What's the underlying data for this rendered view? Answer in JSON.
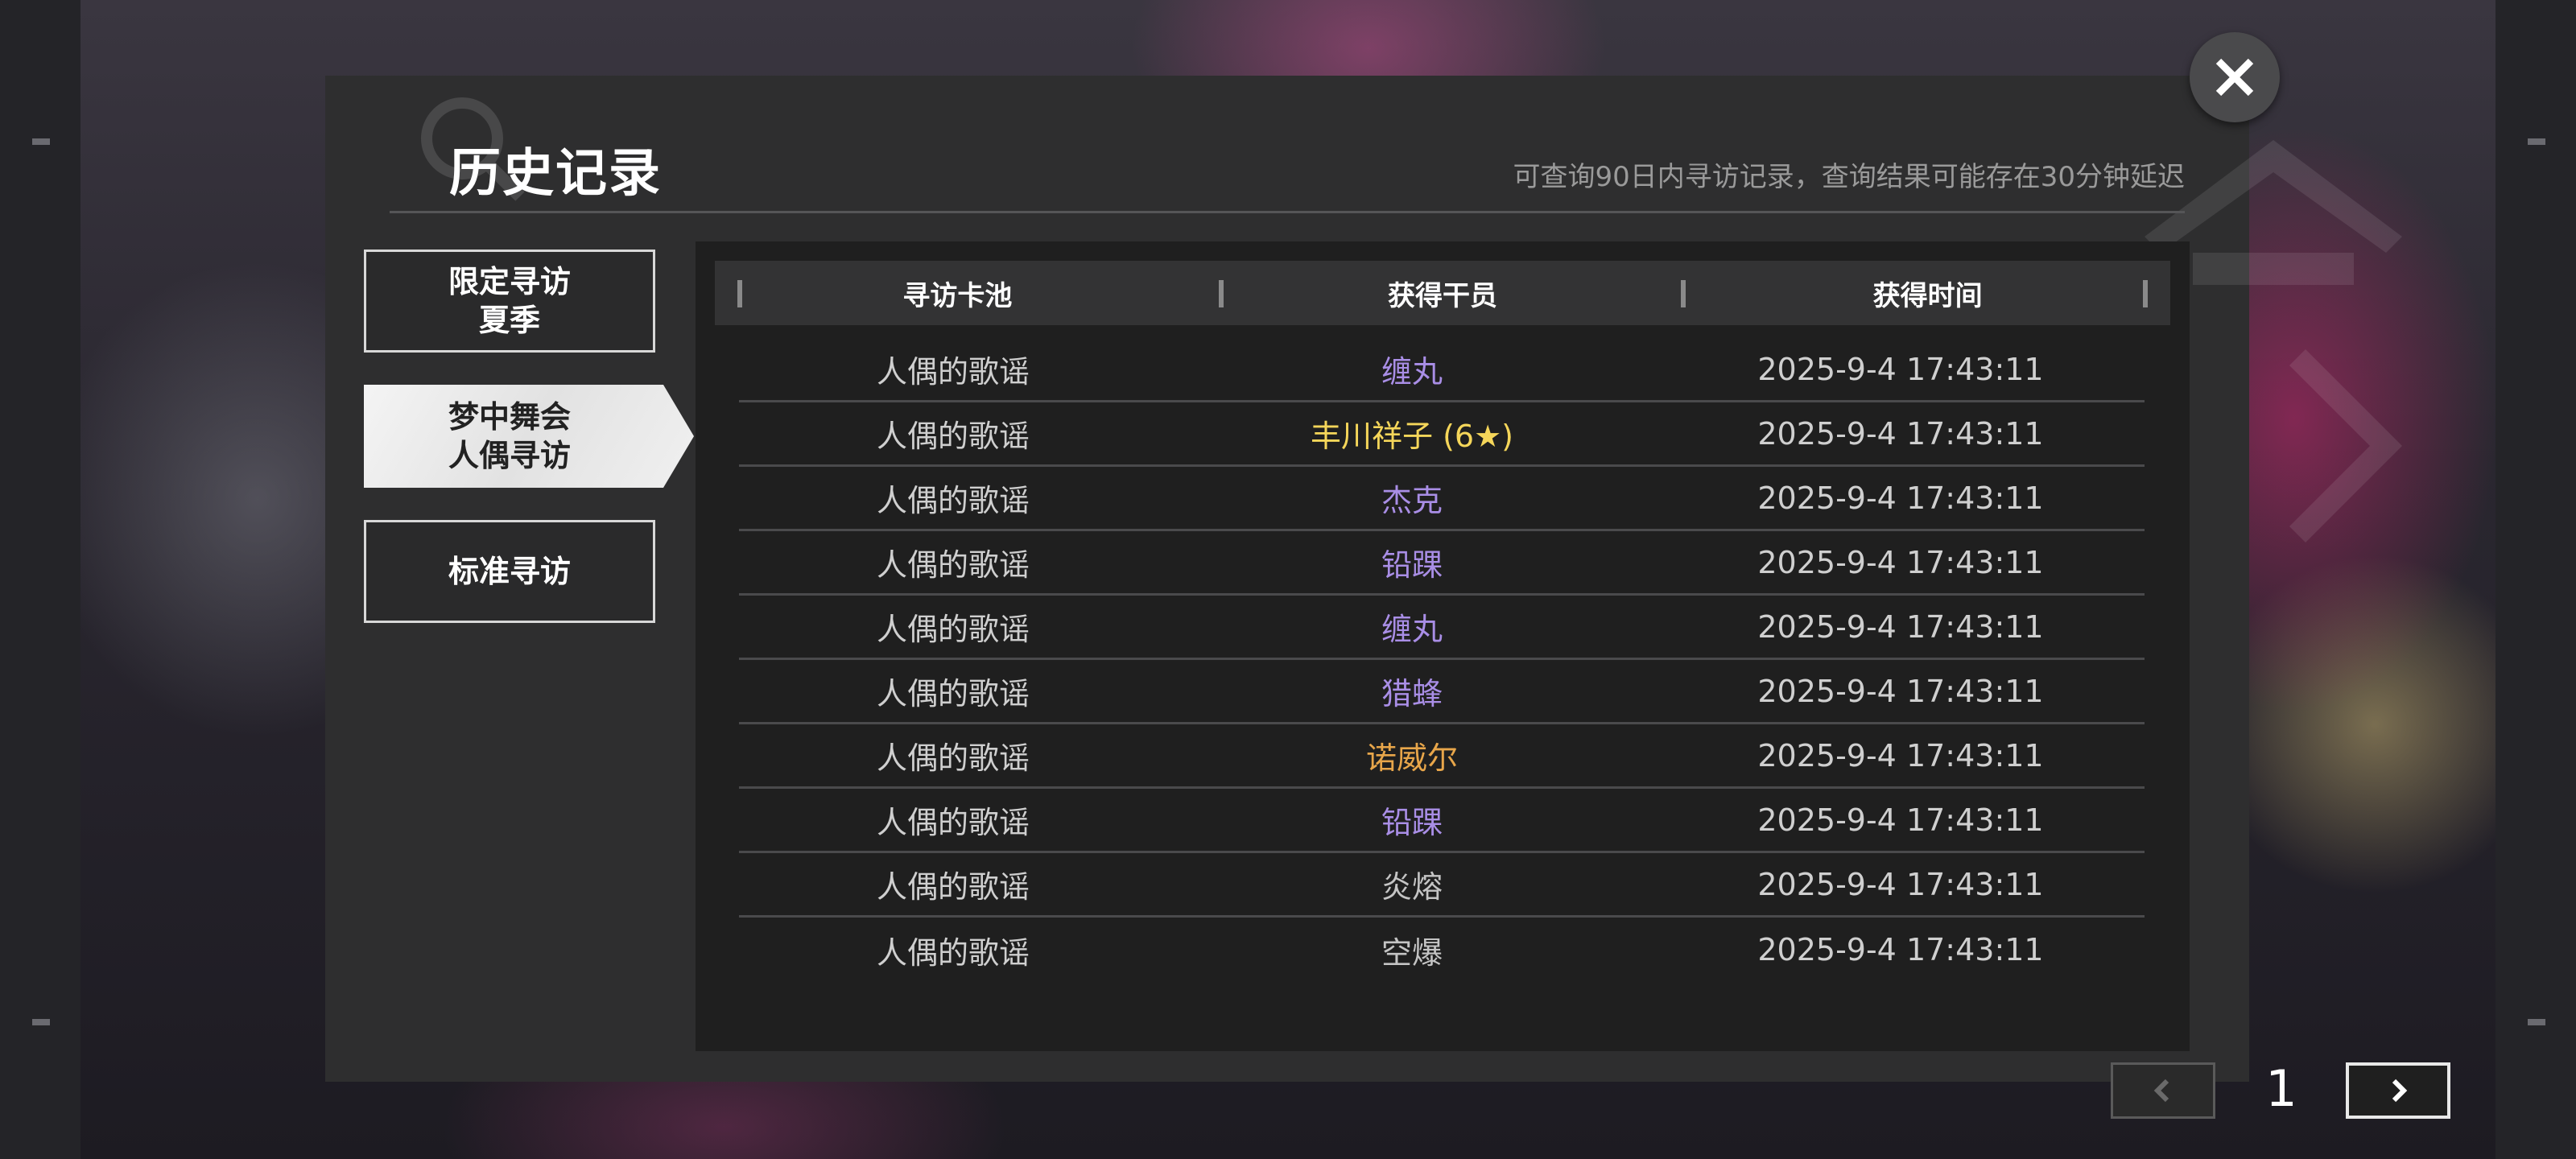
{
  "dialog": {
    "title": "历史记录",
    "subtitle": "可查询90日内寻访记录，查询结果可能存在30分钟延迟"
  },
  "tabs": [
    {
      "line1": "限定寻访",
      "line2": "夏季",
      "active": false
    },
    {
      "line1": "梦中舞会",
      "line2": "人偶寻访",
      "active": true
    },
    {
      "line1": "标准寻访",
      "line2": "",
      "active": false
    }
  ],
  "table": {
    "headers": [
      "寻访卡池",
      "获得干员",
      "获得时间"
    ],
    "rows": [
      {
        "pool": "人偶的歌谣",
        "operator": "缠丸",
        "time": "2025-9-4 17:43:11",
        "color": "#a98ee6"
      },
      {
        "pool": "人偶的歌谣",
        "operator": "丰川祥子 (6★)",
        "time": "2025-9-4 17:43:11",
        "color": "#f5d65a"
      },
      {
        "pool": "人偶的歌谣",
        "operator": "杰克",
        "time": "2025-9-4 17:43:11",
        "color": "#a98ee6"
      },
      {
        "pool": "人偶的歌谣",
        "operator": "铅踝",
        "time": "2025-9-4 17:43:11",
        "color": "#a98ee6"
      },
      {
        "pool": "人偶的歌谣",
        "operator": "缠丸",
        "time": "2025-9-4 17:43:11",
        "color": "#a98ee6"
      },
      {
        "pool": "人偶的歌谣",
        "operator": "猎蜂",
        "time": "2025-9-4 17:43:11",
        "color": "#a98ee6"
      },
      {
        "pool": "人偶的歌谣",
        "operator": "诺威尔",
        "time": "2025-9-4 17:43:11",
        "color": "#e8a64a"
      },
      {
        "pool": "人偶的歌谣",
        "operator": "铅踝",
        "time": "2025-9-4 17:43:11",
        "color": "#a98ee6"
      },
      {
        "pool": "人偶的歌谣",
        "operator": "炎熔",
        "time": "2025-9-4 17:43:11",
        "color": "#c4c4c4"
      },
      {
        "pool": "人偶的歌谣",
        "operator": "空爆",
        "time": "2025-9-4 17:43:11",
        "color": "#c4c4c4"
      }
    ]
  },
  "pagination": {
    "page": "1"
  },
  "icons": {
    "close": "close-icon",
    "prev": "chevron-left-icon",
    "next": "chevron-right-icon"
  }
}
